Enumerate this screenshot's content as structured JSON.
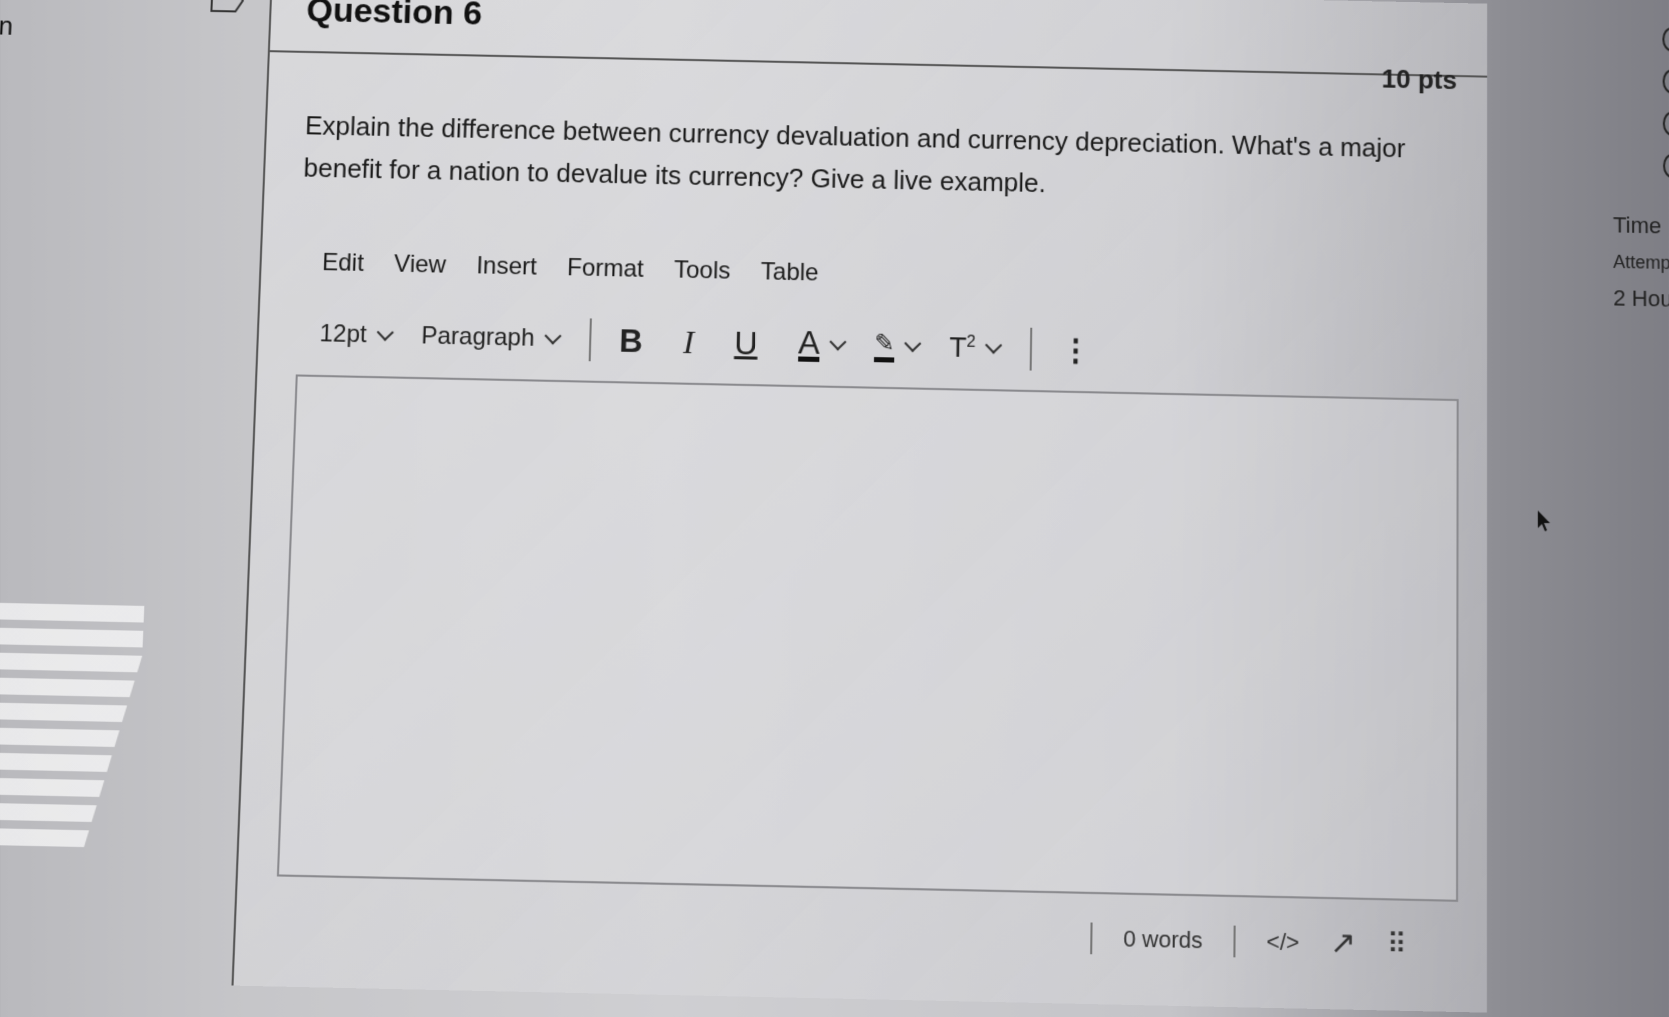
{
  "question": {
    "title": "Question 6",
    "points": "10 pts",
    "prompt": "Explain the difference between currency devaluation and currency depreciation. What's a major benefit for a nation to devalue its currency? Give a live example."
  },
  "editor": {
    "menu": [
      "Edit",
      "View",
      "Insert",
      "Format",
      "Tools",
      "Table"
    ],
    "font_size": "12pt",
    "block_format": "Paragraph",
    "toolbar_icons": [
      "bold-icon",
      "italic-icon",
      "underline-icon",
      "text-color-icon",
      "highlight-color-icon",
      "superscript-icon",
      "more-options-icon"
    ],
    "toolbar_glyphs": {
      "bold": "B",
      "italic": "I",
      "underline": "U",
      "text_color": "A",
      "highlight": "✎",
      "superscript_base": "T",
      "superscript_exp": "2",
      "more": "⋮"
    },
    "content": "",
    "status": {
      "word_count": "0 words",
      "html_toggle": "</>",
      "fullscreen_icon": "↗",
      "resize_icon": "⠿"
    }
  },
  "side_panel": {
    "time_label": "Time",
    "attempt_label": "Attemp",
    "duration": "2 Hou"
  },
  "left_stub_text": "n"
}
